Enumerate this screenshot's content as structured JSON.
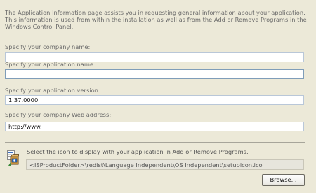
{
  "intro_text": "The Application Information page assists you in requesting general information about your application. This information is used from within the installation as well as from the Add or Remove Programs in the Windows Control Panel.",
  "fields": {
    "company_name": {
      "label": "Specify your company name:",
      "value": ""
    },
    "application_name": {
      "label": "Specify your application name:",
      "value": ""
    },
    "application_version": {
      "label": "Specify your application version:",
      "value": "1.37.0000"
    },
    "company_web": {
      "label": "Specify your company Web address:",
      "value": "http://www."
    }
  },
  "icon_section": {
    "label": "Select the icon to display with your application in Add or Remove Programs.",
    "path": "<ISProductFolder>\\redist\\Language Independent\\OS Independent\\setupicon.ico",
    "icon": "setup-installer-icon",
    "browse_label": "Browse..."
  }
}
